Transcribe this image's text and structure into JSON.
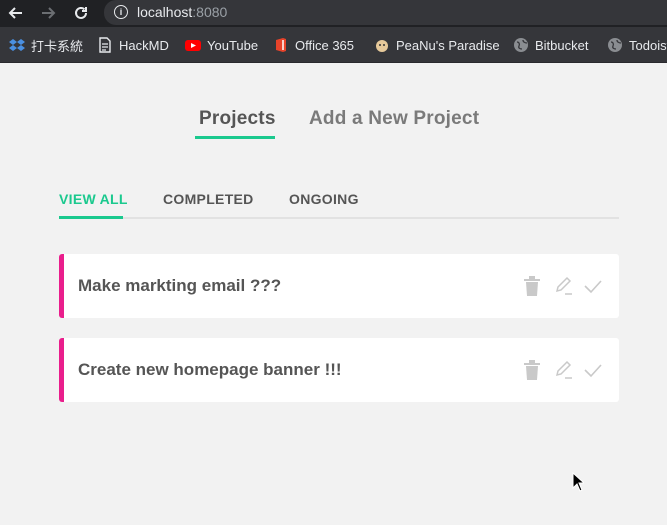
{
  "browser": {
    "url_host": "localhost",
    "url_port": ":8080",
    "bookmarks": [
      {
        "label": "打卡系統",
        "icon": "dropbox-icon"
      },
      {
        "label": "HackMD",
        "icon": "document-icon"
      },
      {
        "label": "YouTube",
        "icon": "youtube-icon"
      },
      {
        "label": "Office 365",
        "icon": "office-icon"
      },
      {
        "label": "PeaNu's Paradise",
        "icon": "peanut-icon"
      },
      {
        "label": "Bitbucket",
        "icon": "globe-icon"
      },
      {
        "label": "Todoist",
        "icon": "globe-icon"
      }
    ]
  },
  "header": {
    "tabs": [
      {
        "label": "Projects",
        "active": true
      },
      {
        "label": "Add a New Project",
        "active": false
      }
    ]
  },
  "filters": [
    {
      "label": "VIEW ALL",
      "active": true
    },
    {
      "label": "COMPLETED",
      "active": false
    },
    {
      "label": "ONGOING",
      "active": false
    }
  ],
  "projects": [
    {
      "title": "Make markting email ???"
    },
    {
      "title": "Create new homepage banner !!!"
    }
  ],
  "colors": {
    "accent": "#1bc98e",
    "card_border": "#e91e8c",
    "page_bg": "#f2f2f2"
  }
}
